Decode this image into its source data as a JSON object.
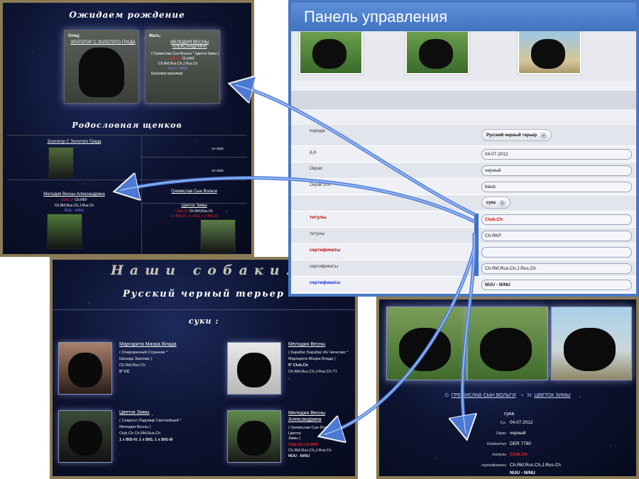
{
  "screen1": {
    "title": "Ожидаем рождение",
    "father_label": "Отец:",
    "father_name": "ЗЛАТОГОР С ЗОЛОТОГО ГРАДА",
    "mother_label": "Мать:",
    "mother_name": "МЕЛОДИЯ ВЕСНЫ АЛЕКСАНДРИНА",
    "mother_parents": "( Гремислав Сын Вольги * Цветок Зимы )",
    "mother_club": "Club.Ch",
    "mother_titles_a": "Ch.RKF",
    "mother_titles_b": "Ch.Rkf,Rus.Ch,J.Rus.Ch",
    "mother_nuu": "NUU - N/NU",
    "mother_note": "Красивая красивая",
    "pedigree_title": "Родословная щенков",
    "ped_father": "Златогор С Золотого Града",
    "ped_mother": "Мелодия Весны Александрина",
    "ped_mother_club": "Club.Ch",
    "ped_mother_titles_a": "Ch.RKF",
    "ped_mother_titles_b": "Ch.Rkf,Rus.Ch,J.Rus.Ch",
    "ped_mother_nuu": "NUU - N/NU",
    "no_data_1": "no data",
    "no_data_2": "no data",
    "ped_grandfather": "Гремислав Сын Вольги",
    "ped_grandmother": "Цветок Зимы",
    "ped_grandmother_club": "Club.Ch",
    "ped_grandmother_titles": "Ch.Rkf,Rus.Ch",
    "ped_grandmother_bis": "1 x BIS-IV, 1 x BIG, 1 x BIG-III"
  },
  "panel": {
    "title": "Панель управления",
    "fields": [
      {
        "label": "порода",
        "value": "Русский черный терьер",
        "type": "select",
        "style": ""
      },
      {
        "label": "д.р.",
        "value": "04.07.2012",
        "type": "input",
        "style": ""
      },
      {
        "label": "Окрас",
        "value": "черный",
        "type": "input",
        "style": ""
      },
      {
        "label": "Окрас EN",
        "value": "black",
        "type": "input",
        "style": ""
      },
      {
        "label": "",
        "value": "сука",
        "type": "select",
        "style": ""
      },
      {
        "label": "титулы",
        "value": "Club.Ch",
        "type": "input",
        "style": "red"
      },
      {
        "label": "титулы",
        "value": "Ch.RKF",
        "type": "input",
        "style": ""
      },
      {
        "label": "сертификаты",
        "value": "",
        "type": "input",
        "style": "red"
      },
      {
        "label": "сертификаты",
        "value": "Ch.Rkf,Rus.Ch,J.Rus.Ch",
        "type": "input",
        "style": ""
      },
      {
        "label": "сертификаты",
        "value": "NUU - N/NU",
        "type": "input",
        "style": "blue"
      }
    ]
  },
  "screen2": {
    "title": "Наши собаки.",
    "breed": "Русский черный терьер",
    "section": "суки :",
    "dogs": [
      {
        "name": "Маргарита Маэра Влада",
        "l1": "( Очарованный Странник *",
        "l2": "Шахида Зазнова )",
        "l3": "Ch.Rkf,Rus.Ch",
        "l4": "5* CC",
        "l5": ""
      },
      {
        "name": "Мелодия Весны",
        "l1": "( Карабас Барабас Из Чигасово *",
        "l2": "Маргарита Маэра Влада )",
        "l3": "5* Club.Ch",
        "l4": "Ch.Rkf,Rus.Ch,J.Rus.Ch T1",
        "l5": ""
      },
      {
        "name": "Цветок Зимы",
        "l1": "( Самросс Радомир Светлейший *",
        "l2": "Мелодия Весны )",
        "l3": "Club.Ch Ch.Rkf,Rus.Ch",
        "l4": "1 x BIS-IV, 1 x BIG, 1 x BIG-III",
        "l5": ""
      },
      {
        "name": "Мелодия Весны Александрина",
        "l1": "( Гремислав Сын Вольги *",
        "l2": "Цветок",
        "l3": "Зимы )",
        "l4": "Club.Ch Ch.RKF",
        "l5": "Ch.Rkf,Rus.Ch,J.Rus.Ch",
        "l6": "NUU - N/NU"
      }
    ]
  },
  "screen3": {
    "father_prefix": "О.",
    "father": "ГРЕМИСЛАВ СЫН ВОЛЬГИ",
    "mother_prefix": "М.",
    "mother": "ЦВЕТОК ЗИМЫ",
    "sex": "сука",
    "rows": [
      {
        "k": "д.р.",
        "v": "04.07.2012"
      },
      {
        "k": "Окрас",
        "v": "черный"
      },
      {
        "k": "Клеймо/чип",
        "v": "DER 7780"
      },
      {
        "k": "титулы",
        "v": "Club.Ch Ch.RKF"
      },
      {
        "k": "сертификаты",
        "v": "Ch.Rkf,Rus.Ch,J.Rus.Ch"
      }
    ],
    "nuu": "NUU - N/NU"
  },
  "colors": {
    "accent": "#3f72c0",
    "title_red": "#ff2020",
    "nuu_blue": "#7d8cff",
    "arrow": "#4f7fdc"
  }
}
